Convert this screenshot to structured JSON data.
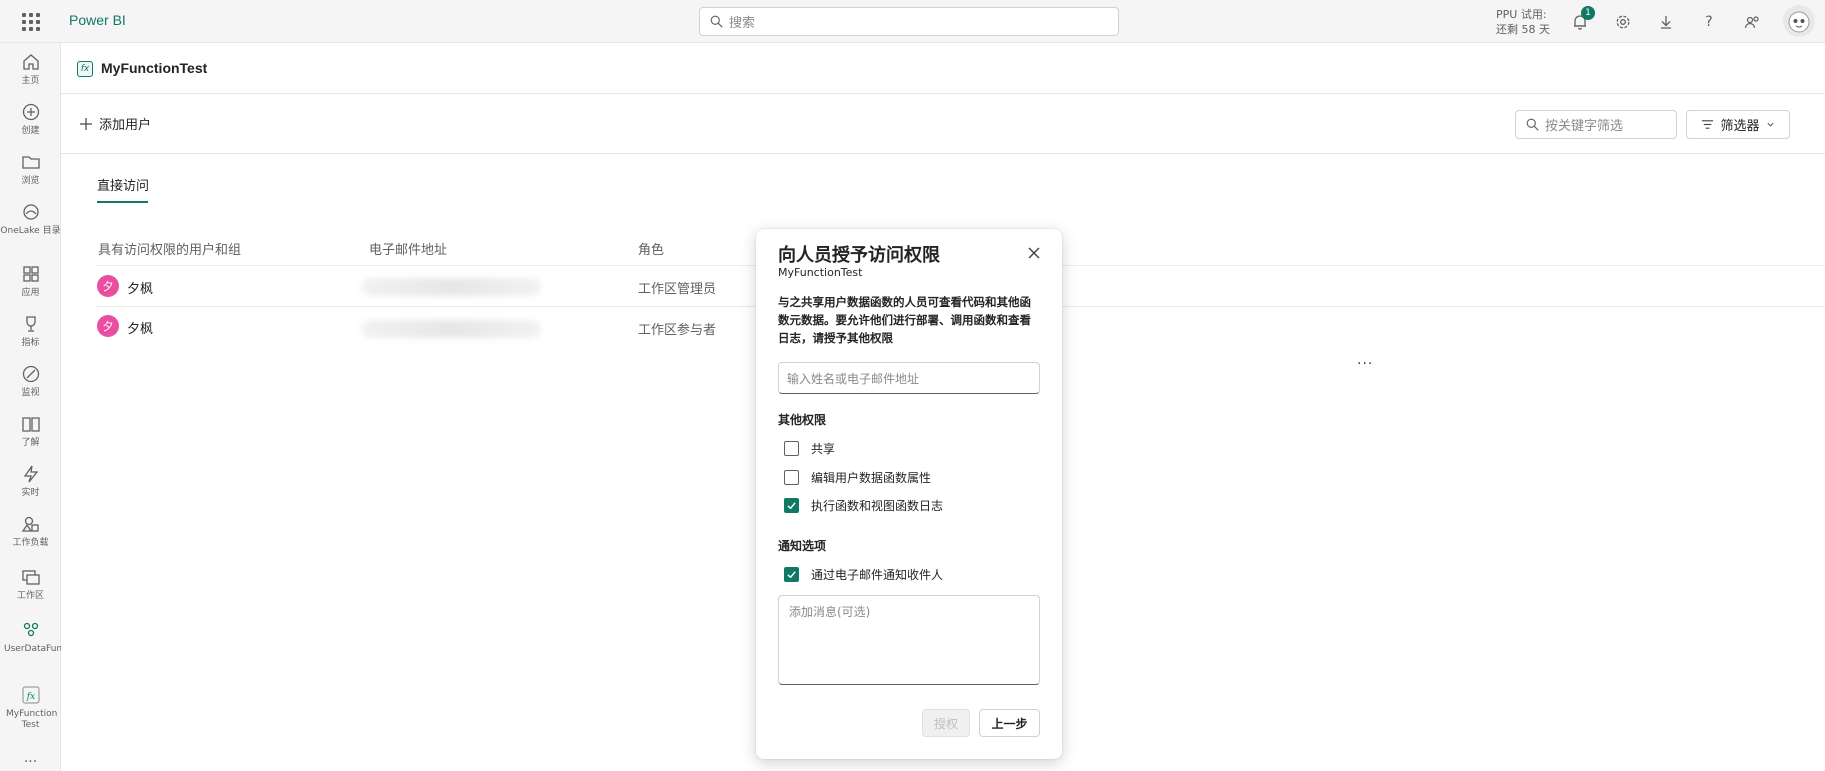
{
  "topbar": {
    "brand": "Power BI",
    "search_placeholder": "搜索",
    "ppu_line1": "PPU 试用:",
    "ppu_line2": "还剩 58 天",
    "notification_count": "1"
  },
  "leftnav": {
    "items": [
      {
        "label": "主页",
        "icon": "home-icon"
      },
      {
        "label": "创建",
        "icon": "create-icon"
      },
      {
        "label": "浏览",
        "icon": "folder-icon"
      },
      {
        "label": "OneLake 目录",
        "icon": "onelake-icon"
      },
      {
        "label": "应用",
        "icon": "apps-icon"
      },
      {
        "label": "指标",
        "icon": "trophy-icon"
      },
      {
        "label": "监视",
        "icon": "monitor-icon"
      },
      {
        "label": "了解",
        "icon": "book-icon"
      },
      {
        "label": "实时",
        "icon": "realtime-icon"
      },
      {
        "label": "工作负载",
        "icon": "workload-icon"
      },
      {
        "label": "工作区",
        "icon": "workspace-icon"
      },
      {
        "label": "UserDataFunctionsWo...",
        "icon": "people-icon"
      },
      {
        "label": "MyFunction Test",
        "icon": "function-icon"
      }
    ],
    "more": "..."
  },
  "item": {
    "title": "MyFunctionTest",
    "icon_text": "fx"
  },
  "actions": {
    "add_user": "添加用户",
    "keyword_filter_placeholder": "按关键字筛选",
    "filter_label": "筛选器"
  },
  "tabs": {
    "direct_access": "直接访问"
  },
  "table": {
    "headers": [
      "具有访问权限的用户和组",
      "电子邮件地址",
      "角色"
    ],
    "rows": [
      {
        "avatar": "夕",
        "name": "夕枫",
        "role": "工作区管理员"
      },
      {
        "avatar": "夕",
        "name": "夕枫",
        "role": "工作区参与者"
      }
    ],
    "more": "···"
  },
  "dialog": {
    "title": "向人员授予访问权限",
    "subtitle": "MyFunctionTest",
    "description": "与之共享用户数据函数的人员可查看代码和其他函数元数据。要允许他们进行部署、调用函数和查看日志，请授予其他权限",
    "input_placeholder": "输入姓名或电子邮件地址",
    "other_permissions_label": "其他权限",
    "permissions": [
      {
        "label": "共享",
        "checked": false
      },
      {
        "label": "编辑用户数据函数属性",
        "checked": false
      },
      {
        "label": "执行函数和视图函数日志",
        "checked": true
      }
    ],
    "notify_label": "通知选项",
    "notify_option": {
      "label": "通过电子邮件通知收件人",
      "checked": true
    },
    "message_placeholder": "添加消息(可选)",
    "grant_button": "授权",
    "back_button": "上一步"
  },
  "colors": {
    "accent": "#117865",
    "avatar": "#e94ea0"
  }
}
